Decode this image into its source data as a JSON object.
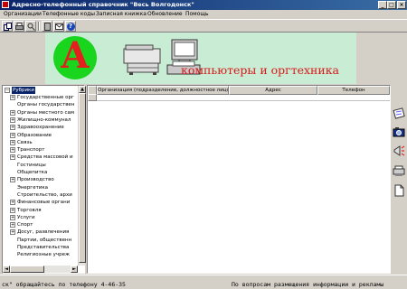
{
  "window": {
    "title": "Адресно-телефонный справочник \"Весь Волгодонск\""
  },
  "menu": [
    "Организации",
    "Телефонные коды",
    "Записная книжка",
    "Обновление",
    "Помощь"
  ],
  "toolbar": {
    "icons": [
      "copy-icon",
      "print-icon",
      "search-icon",
      "bookmark-icon",
      "mail-icon",
      "help-icon"
    ],
    "help_glyph": "?"
  },
  "banner": {
    "logo_letter": "А",
    "text": "компьютеры и оргтехника",
    "colors": {
      "logo": "#19d51e",
      "letter": "#e31f1f",
      "text": "#d81818",
      "bg": "#c8ecd4"
    }
  },
  "tree": {
    "root": "Рубрики",
    "items": [
      {
        "label": "Государственные орг",
        "expandable": true
      },
      {
        "label": "Органы государствен",
        "expandable": false
      },
      {
        "label": "Органы местного сам",
        "expandable": true
      },
      {
        "label": "Жилищно-коммунал",
        "expandable": true
      },
      {
        "label": "Здравоохранение",
        "expandable": true
      },
      {
        "label": "Образование",
        "expandable": true
      },
      {
        "label": "Связь",
        "expandable": true
      },
      {
        "label": "Транспорт",
        "expandable": true
      },
      {
        "label": "Средства массовой и",
        "expandable": true
      },
      {
        "label": "Гостиницы",
        "expandable": false
      },
      {
        "label": "Общепитка",
        "expandable": false
      },
      {
        "label": "Производство",
        "expandable": true
      },
      {
        "label": "Энергетика",
        "expandable": false
      },
      {
        "label": "Строительство, архи",
        "expandable": false
      },
      {
        "label": "Финансовые органи",
        "expandable": true
      },
      {
        "label": "Торговля",
        "expandable": true
      },
      {
        "label": "Услуги",
        "expandable": true
      },
      {
        "label": "Спорт",
        "expandable": true
      },
      {
        "label": "Досуг, развлечения",
        "expandable": true
      },
      {
        "label": "Партии, общественн",
        "expandable": false
      },
      {
        "label": "Представительства",
        "expandable": false
      },
      {
        "label": "Религиозные учреж",
        "expandable": false
      }
    ]
  },
  "grid": {
    "columns": [
      "Организация (подразделение, должностное лицо)",
      "Адрес",
      "Телефон"
    ]
  },
  "side_icons": [
    "notepad-icon",
    "camera-icon",
    "megaphone-icon",
    "copier-icon",
    "document-icon"
  ],
  "status": {
    "left": "ск\" обращайтесь по телефону 4-46-35",
    "right": "По вопросам размещения информации и рекламы"
  }
}
